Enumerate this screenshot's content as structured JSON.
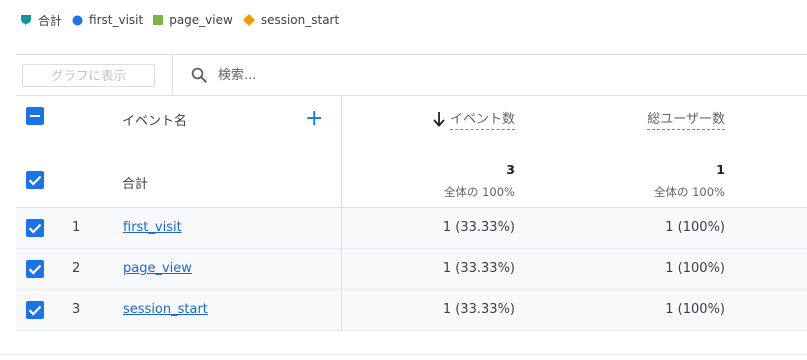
{
  "legend": [
    {
      "label": "合計",
      "icon": "teardrop-icon",
      "color": "#12939a"
    },
    {
      "label": "first_visit",
      "icon": "circle-icon",
      "color": "#1a73e8"
    },
    {
      "label": "page_view",
      "icon": "square-icon",
      "color": "#7cb342"
    },
    {
      "label": "session_start",
      "icon": "diamond-icon",
      "color": "#f29900"
    }
  ],
  "toolbar": {
    "chart_button_label": "グラフに表示",
    "search_placeholder": "検索..."
  },
  "table": {
    "headers": {
      "event_name": "イベント名",
      "add": "+",
      "event_count": "イベント数",
      "total_users": "総ユーザー数"
    },
    "totals": {
      "label": "合計",
      "event_count": "3",
      "event_count_sub": "全体の 100%",
      "total_users": "1",
      "total_users_sub": "全体の 100%"
    },
    "rows": [
      {
        "index": "1",
        "name": "first_visit",
        "event_count": "1 (33.33%)",
        "total_users": "1 (100%)"
      },
      {
        "index": "2",
        "name": "page_view",
        "event_count": "1 (33.33%)",
        "total_users": "1 (100%)"
      },
      {
        "index": "3",
        "name": "session_start",
        "event_count": "1 (33.33%)",
        "total_users": "1 (100%)"
      }
    ]
  },
  "colors": {
    "accent": "#1a73e8",
    "link": "#1967d2"
  }
}
